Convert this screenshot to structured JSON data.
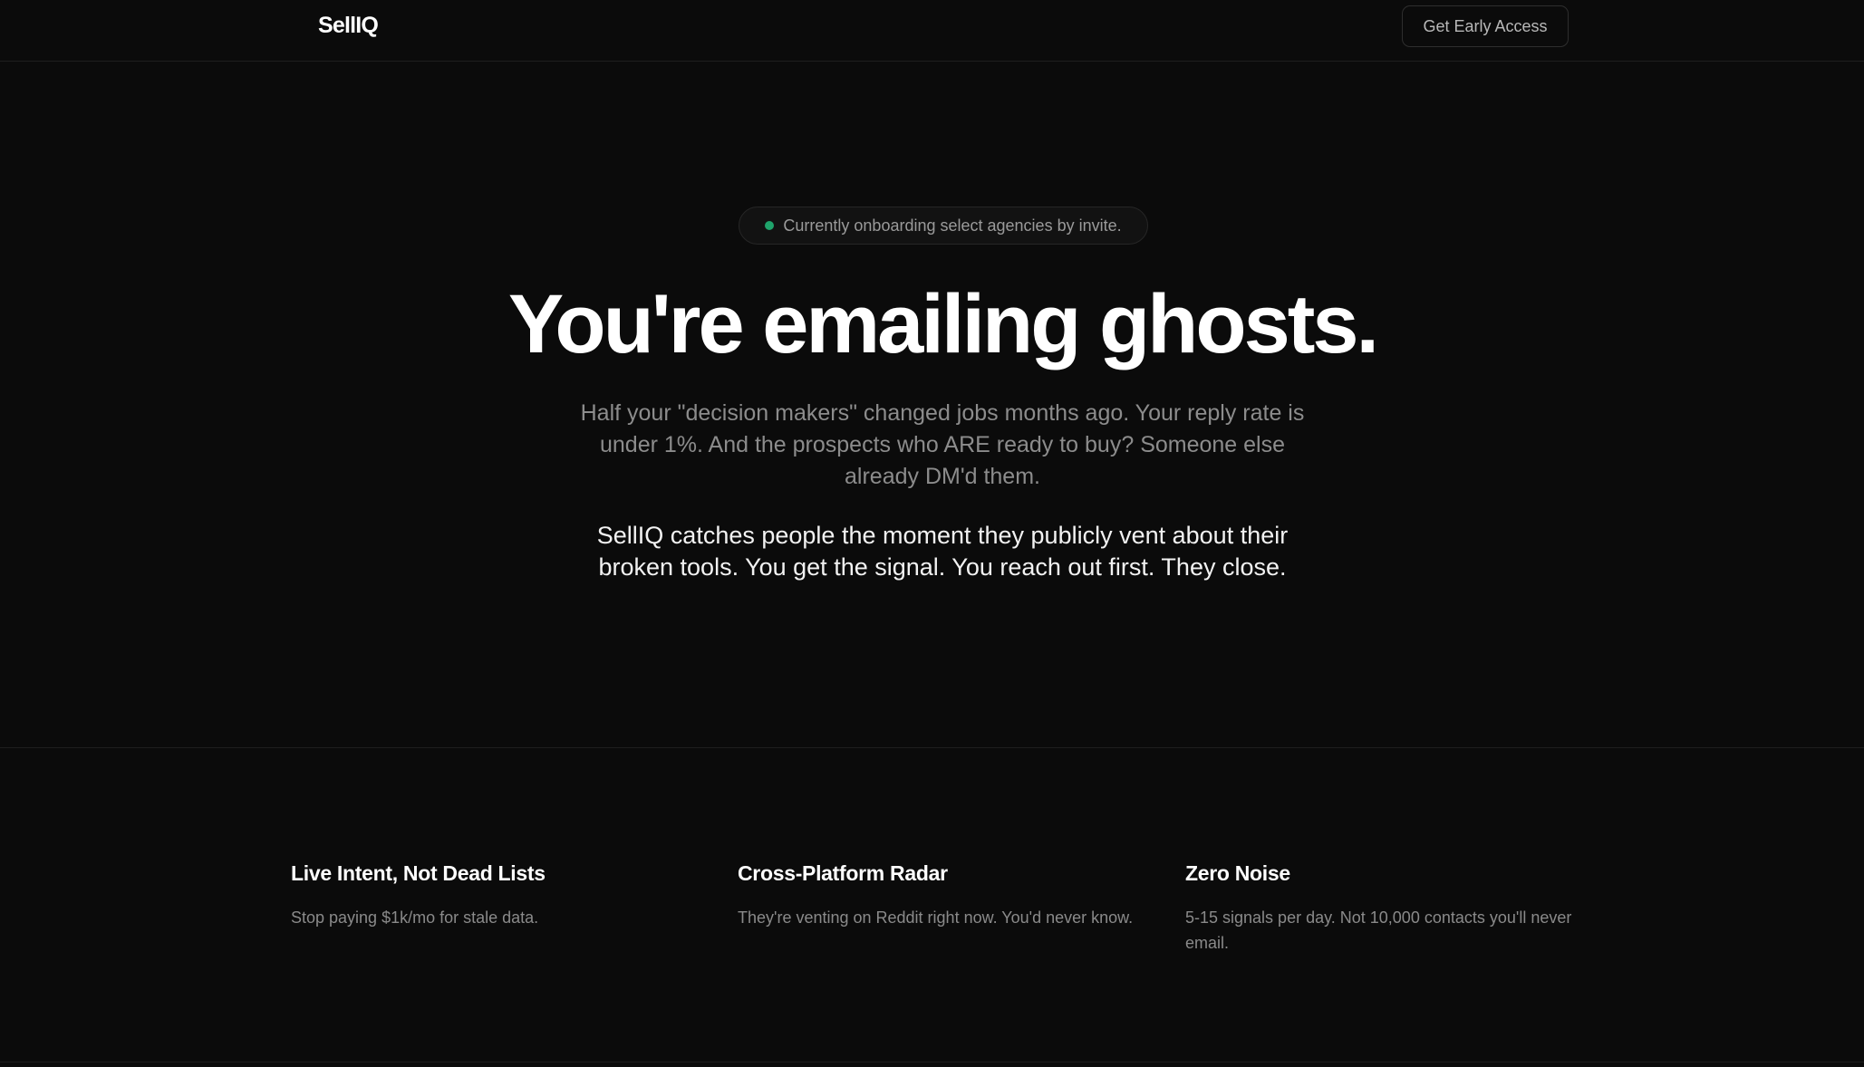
{
  "header": {
    "logo": "SellIQ",
    "cta_label": "Get Early Access"
  },
  "hero": {
    "badge_text": "Currently onboarding select agencies by invite.",
    "title": "You're emailing ghosts.",
    "subtitle": "Half your \"decision makers\" changed jobs months ago. Your reply rate is under 1%. And the prospects who ARE ready to buy? Someone else already DM'd them.",
    "pitch": "SellIQ catches people the moment they publicly vent about their broken tools. You get the signal. You reach out first. They close."
  },
  "features": [
    {
      "title": "Live Intent, Not Dead Lists",
      "description": "Stop paying $1k/mo for stale data."
    },
    {
      "title": "Cross-Platform Radar",
      "description": "They're venting on Reddit right now. You'd never know."
    },
    {
      "title": "Zero Noise",
      "description": "5-15 signals per day. Not 10,000 contacts you'll never email."
    }
  ],
  "colors": {
    "background": "#0b0b0b",
    "status_dot": "#1fa36b",
    "muted_text": "#8c8c8c"
  }
}
